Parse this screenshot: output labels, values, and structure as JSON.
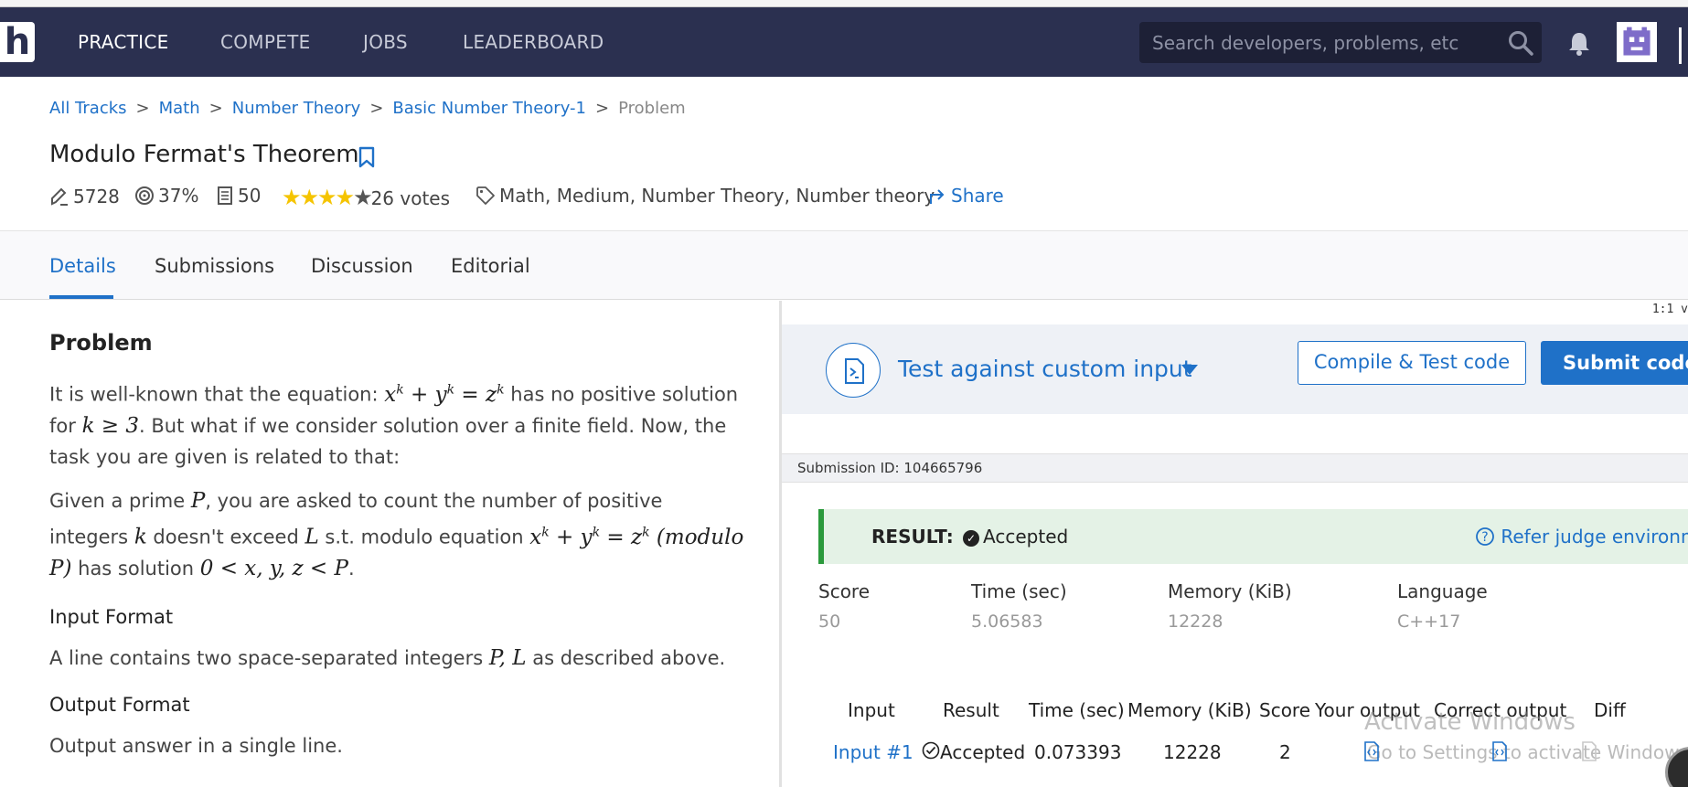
{
  "nav": {
    "logo": "h",
    "links": [
      "PRACTICE",
      "COMPETE",
      "JOBS",
      "LEADERBOARD"
    ],
    "search_placeholder": "Search developers, problems, etc"
  },
  "breadcrumb": [
    "All Tracks",
    "Math",
    "Number Theory",
    "Basic Number Theory-1",
    "Problem"
  ],
  "problem": {
    "title": "Modulo Fermat's Theorem",
    "solvers": "5728",
    "accuracy": "37%",
    "max_score": "50",
    "rating_stars": 4,
    "votes": "26 votes",
    "tags": "Math, Medium, Number Theory, Number theory",
    "share_label": "Share"
  },
  "tabs": [
    "Details",
    "Submissions",
    "Discussion",
    "Editorial"
  ],
  "statement": {
    "heading": "Problem",
    "p1_a": "It is well-known that the equation: ",
    "p1_b": " has no positive solution for ",
    "p1_c": ". But what if we consider solution over a finite field. Now, the task you are given is related to that:",
    "p2_a": "Given a prime ",
    "p2_b": ", you are asked to count the number of positive integers ",
    "p2_c": " doesn't exceed ",
    "p2_d": " s.t. modulo equation ",
    "p2_e": " has solution ",
    "p2_f": ".",
    "input_heading": "Input Format",
    "input_text_a": "A line contains two space-separated integers ",
    "input_text_b": " as described above.",
    "output_heading": "Output Format",
    "output_text": "Output answer in a single line."
  },
  "editor": {
    "ratio": "1:1 v",
    "test_label": "Test against custom input",
    "compile_label": "Compile & Test code",
    "submit_label": "Submit code"
  },
  "submission": {
    "id_text": "Submission ID: 104665796",
    "result_label": "RESULT:",
    "result_value": "Accepted",
    "refer_label": "Refer judge environment",
    "stats_headers": [
      "Score",
      "Time (sec)",
      "Memory (KiB)",
      "Language"
    ],
    "stats_values": [
      "50",
      "5.06583",
      "12228",
      "C++17"
    ],
    "table_headers": [
      "Input",
      "Result",
      "Time (sec)",
      "Memory (KiB)",
      "Score",
      "Your output",
      "Correct output",
      "Diff"
    ],
    "rows": [
      {
        "input": "Input #1",
        "result": "Accepted",
        "time": "0.073393",
        "memory": "12228",
        "score": "2"
      }
    ]
  },
  "os_watermark": {
    "line1": "Activate Windows",
    "line2": "Go to Settings to activate Windows."
  },
  "colors": {
    "nav_bg": "#2b3050",
    "accent": "#1f71c8",
    "success": "#2b9a3c",
    "star": "#f5c400"
  }
}
